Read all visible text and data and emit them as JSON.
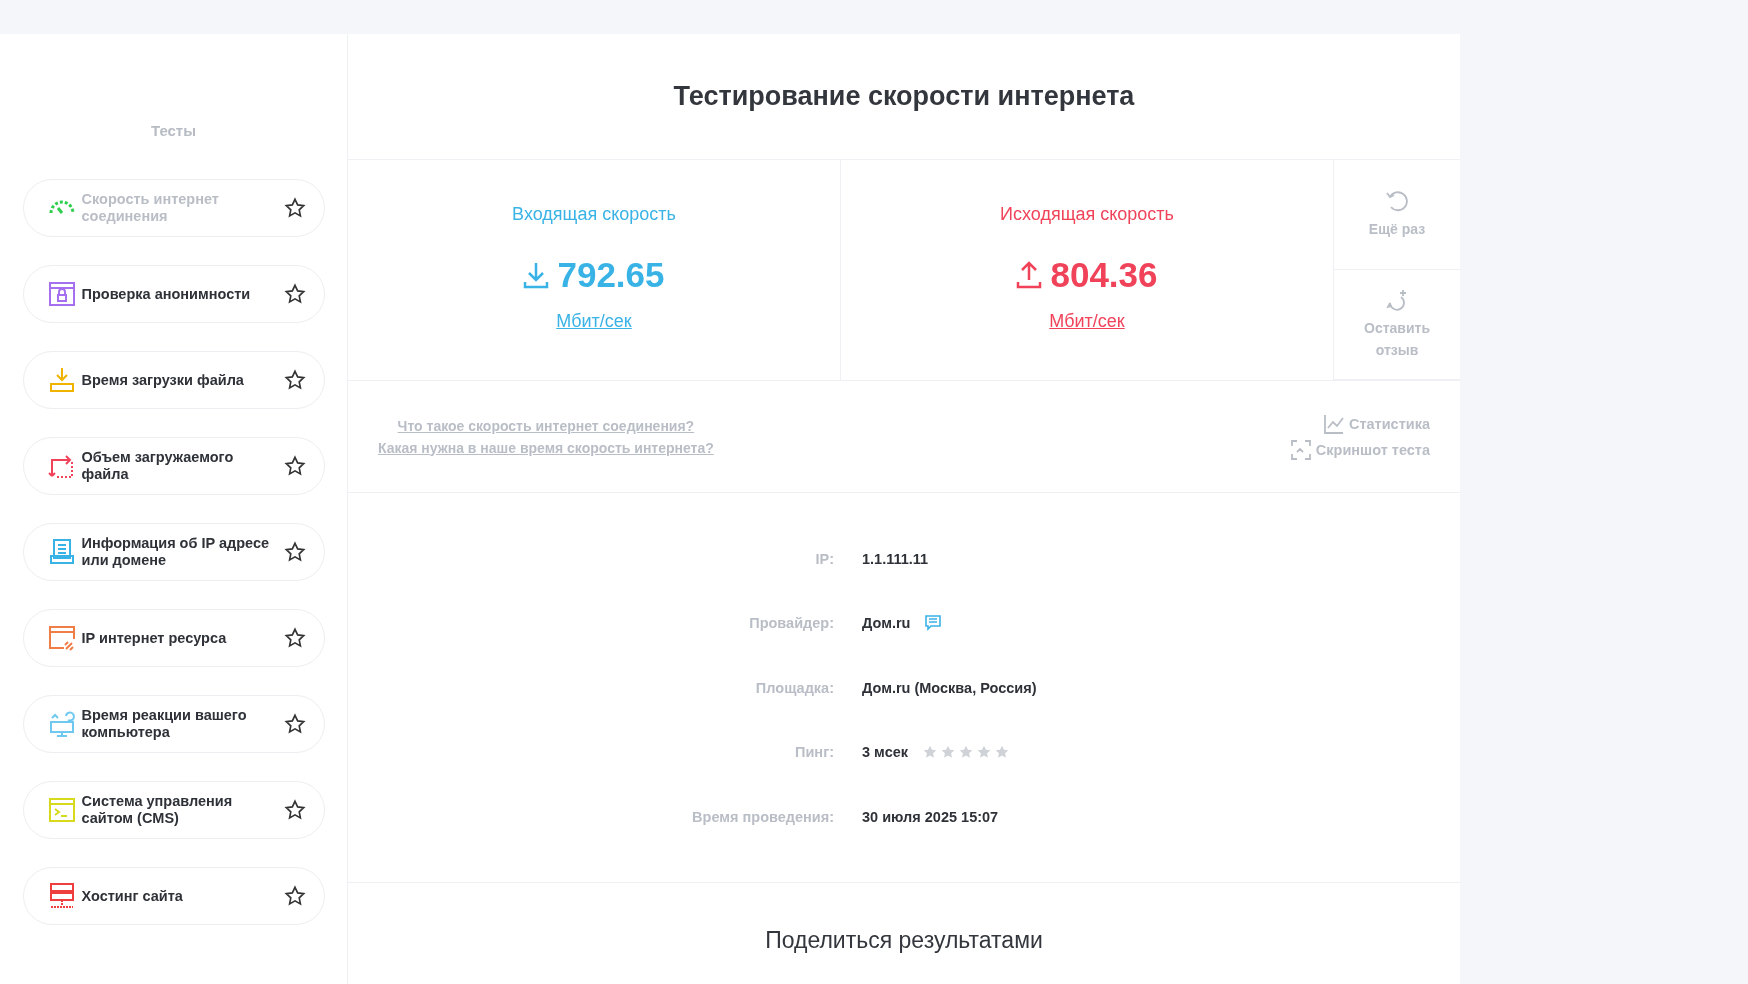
{
  "sidebar": {
    "title": "Тесты",
    "items": [
      {
        "label": "Скорость интернет соединения",
        "kind": "gauge",
        "selected": true
      },
      {
        "label": "Проверка анонимности",
        "kind": "lock",
        "selected": false
      },
      {
        "label": "Время загрузки файла",
        "kind": "download",
        "selected": false
      },
      {
        "label": "Объем загружаемого файла",
        "kind": "resize",
        "selected": false
      },
      {
        "label": "Информация об IP адресе или домене",
        "kind": "document",
        "selected": false
      },
      {
        "label": "IP интернет ресурса",
        "kind": "link",
        "selected": false
      },
      {
        "label": "Время реакции вашего компьютера",
        "kind": "monitor",
        "selected": false
      },
      {
        "label": "Система управления сайтом (CMS)",
        "kind": "terminal",
        "selected": false
      },
      {
        "label": "Хостинг сайта",
        "kind": "server",
        "selected": false
      }
    ]
  },
  "title": "Тестирование скорости интернета",
  "speeds": [
    {
      "kind": "download",
      "label": "Входящая скорость",
      "value": "792.65",
      "unit": "Мбит/сек"
    },
    {
      "kind": "upload",
      "label": "Исходящая скорость",
      "value": "804.36",
      "unit": "Мбит/сек"
    }
  ],
  "actions": [
    {
      "kind": "retry",
      "label": "Ещё раз"
    },
    {
      "kind": "review",
      "label": "Оставить отзыв"
    }
  ],
  "links": [
    "Что такое скорость интернет соединения?",
    "Какая нужна в наше время скорость интернета?"
  ],
  "tools": [
    {
      "kind": "chart",
      "label": "Статистика"
    },
    {
      "kind": "screenshot",
      "label": "Скриншот теста"
    }
  ],
  "info": [
    {
      "label": "IP:",
      "value": "1.1.111.11"
    },
    {
      "label": "Провайдер:",
      "value": "Дом.ru",
      "kind": "comment"
    },
    {
      "label": "Площадка:",
      "value": "Дом.ru (Москва, Россия)"
    },
    {
      "label": "Пинг:",
      "value": "3 мсек",
      "kind": "rating",
      "stars": 0
    },
    {
      "label": "Время проведения:",
      "value": "30 июля 2025 15:07"
    }
  ],
  "share_title": "Поделиться результатами"
}
